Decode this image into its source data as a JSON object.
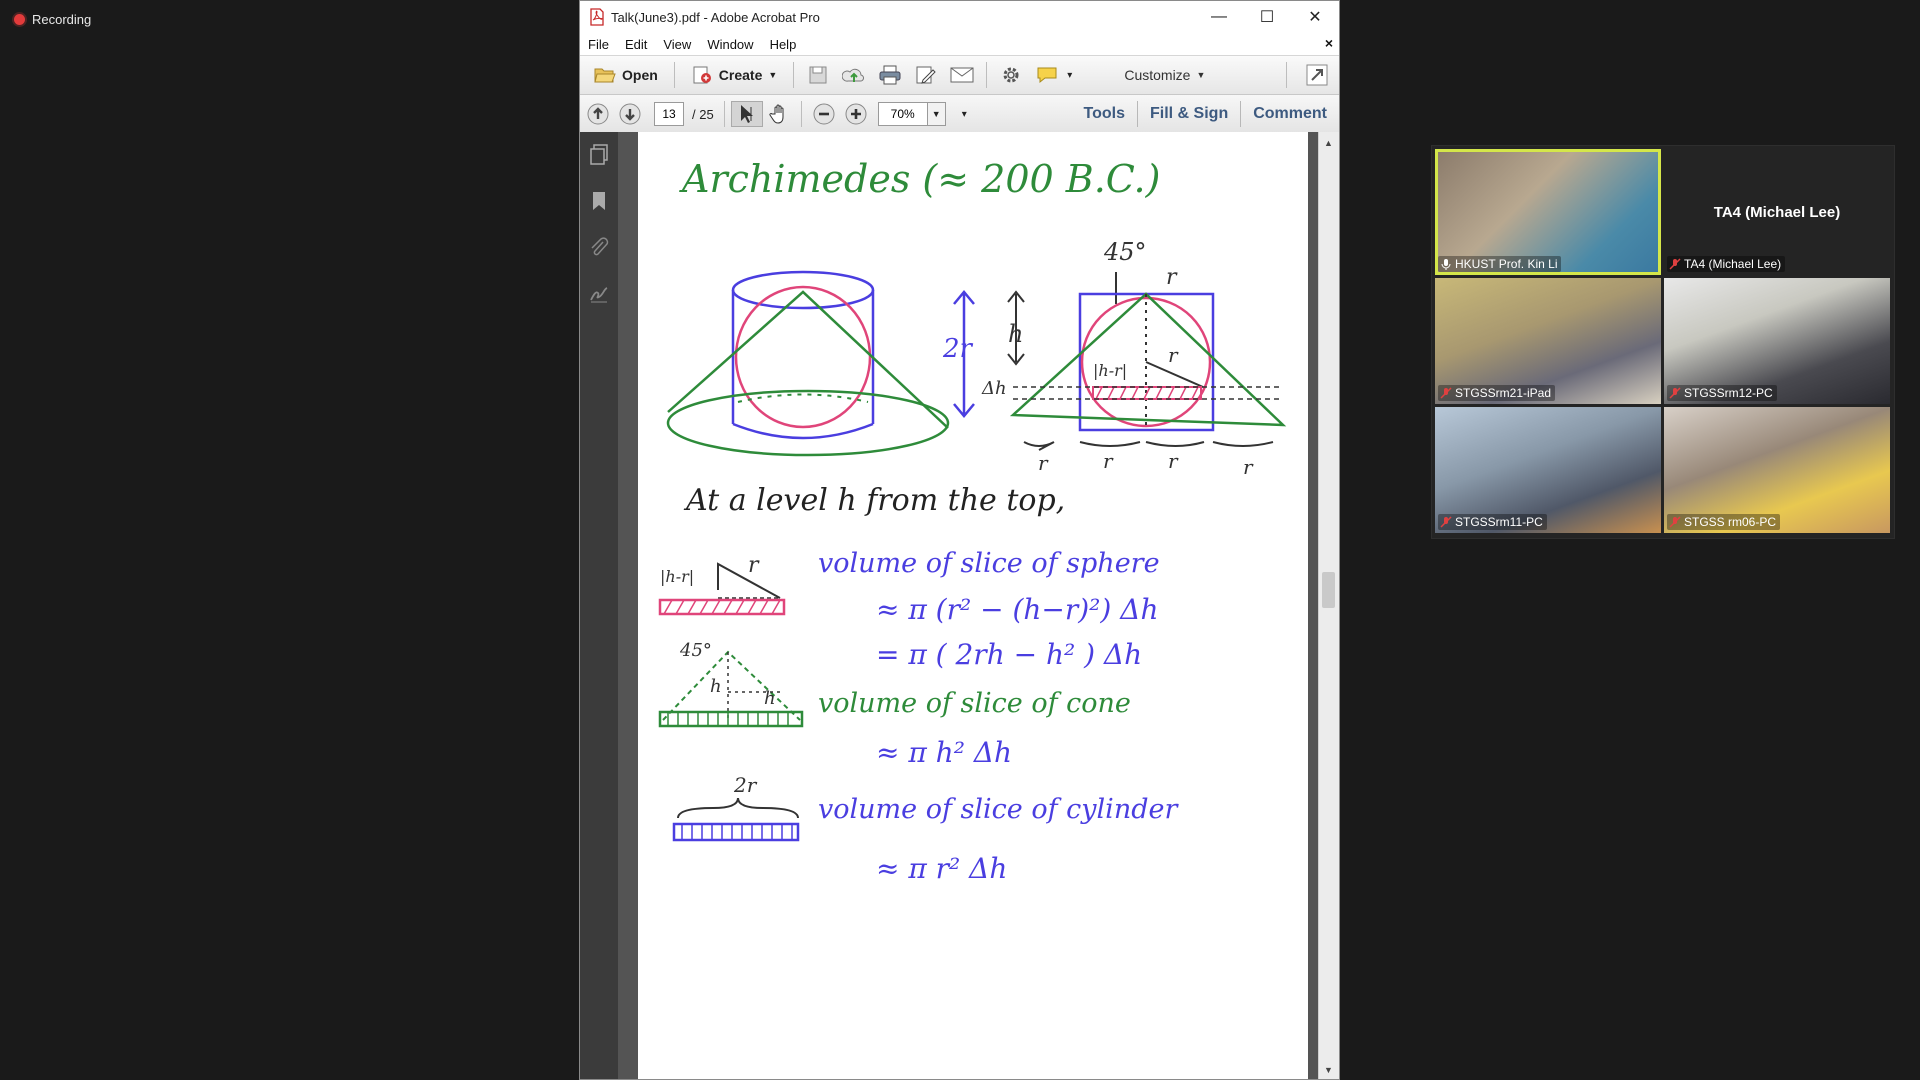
{
  "recording": {
    "label": "Recording"
  },
  "window": {
    "title": "Talk(June3).pdf - Adobe Acrobat Pro",
    "controls": {
      "minimize": "—",
      "maximize": "☐",
      "close": "✕"
    }
  },
  "menu": {
    "items": [
      "File",
      "Edit",
      "View",
      "Window",
      "Help"
    ],
    "close": "×"
  },
  "toolbar": {
    "open_label": "Open",
    "create_label": "Create",
    "customize_label": "Customize"
  },
  "navbar": {
    "page_current": "13",
    "page_total": "/ 25",
    "zoom": "70%",
    "tools_label": "Tools",
    "fill_sign_label": "Fill & Sign",
    "comment_label": "Comment"
  },
  "doc": {
    "title": "Archimedes (≈ 200 B.C.)",
    "top_45": "45°",
    "top_r": "r",
    "label_2r": "2r",
    "label_h": "h",
    "label_dh": "Δh",
    "label_hr": "|h-r|",
    "label_r_mid": "r",
    "bottom_rs": [
      "r",
      "r",
      "r",
      "r"
    ],
    "level_text": "At a level h from the top,",
    "slice_hr": "|h-r|",
    "slice_r": "r",
    "sphere_title": "volume of slice of sphere",
    "sphere_eq1": "≈ π (r² − (h−r)²) Δh",
    "sphere_eq2": "= π ( 2rh − h² ) Δh",
    "cone_45": "45°",
    "cone_h1": "h",
    "cone_h2": "h",
    "cone_title": "volume of slice of cone",
    "cone_eq": "≈ π h² Δh",
    "cyl_2r": "2r",
    "cyl_title": "volume of slice of cylinder",
    "cyl_eq": "≈ π r² Δh"
  },
  "participants": [
    {
      "name": "HKUST Prof. Kin Li",
      "active": true
    },
    {
      "name": "TA4 (Michael Lee)",
      "video": false,
      "display": "TA4 (Michael Lee)"
    },
    {
      "name": "STGSSrm21-iPad"
    },
    {
      "name": "STGSSrm12-PC"
    },
    {
      "name": "STGSSrm11-PC"
    },
    {
      "name": "STGSS rm06-PC"
    }
  ],
  "colors": {
    "green": "#2e8b3a",
    "blue": "#4a3ee0",
    "pink": "#e0457a",
    "highlight": "#d4e64a"
  }
}
